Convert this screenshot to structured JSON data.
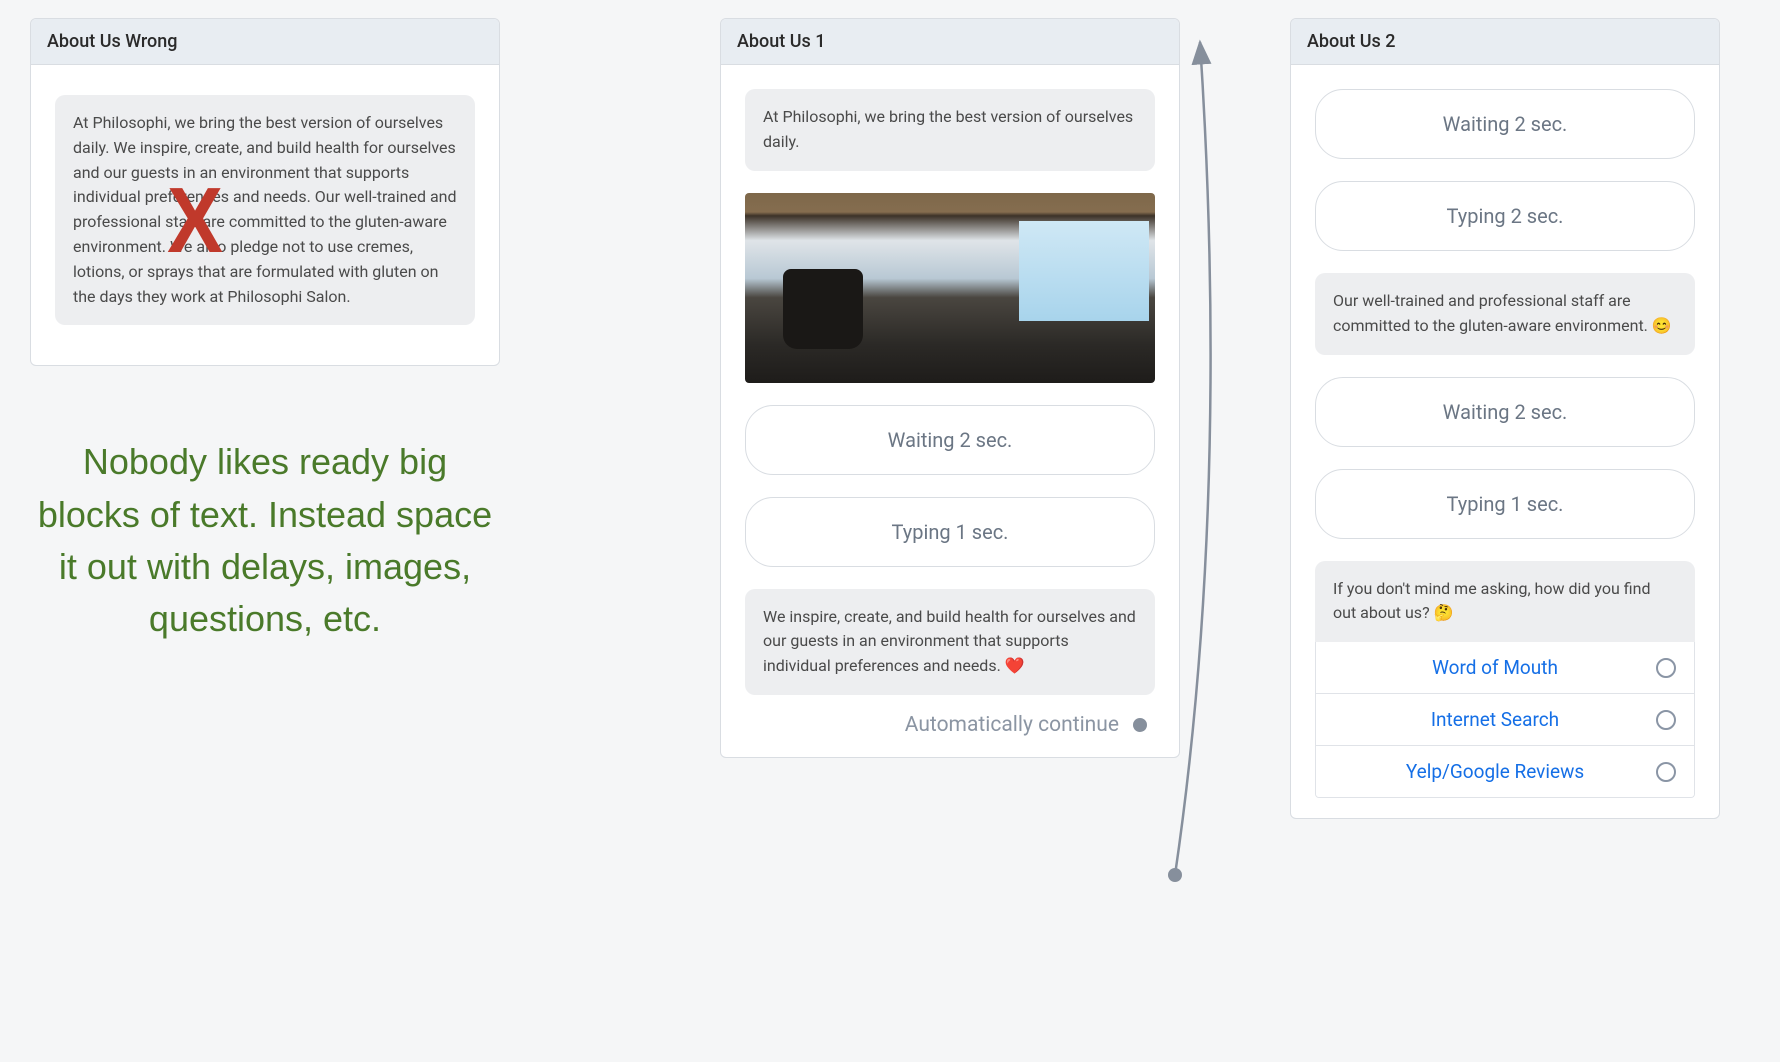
{
  "panels": {
    "wrong": {
      "title": "About Us Wrong",
      "message": "At Philosophi, we bring the best version of ourselves daily. We inspire, create, and build health for ourselves and our guests in an environment that supports individual preferences and needs. Our well-trained and professional staff are committed to the gluten-aware environment. We also pledge not to use cremes, lotions, or sprays that are formulated with gluten on the days they work at Philosophi Salon."
    },
    "one": {
      "title": "About Us 1",
      "intro": "At Philosophi, we bring the best version of ourselves daily.",
      "waiting": "Waiting 2 sec.",
      "typing": "Typing 1 sec.",
      "detail": "We inspire, create, and build health for ourselves and our guests in an environment that supports individual preferences and needs. ❤️",
      "continue": "Automatically continue"
    },
    "two": {
      "title": "About Us 2",
      "waiting1": "Waiting 2 sec.",
      "typing1": "Typing 2 sec.",
      "staff": "Our well-trained and professional staff are committed to the gluten-aware environment. 😊",
      "waiting2": "Waiting 2 sec.",
      "typing2": "Typing 1 sec.",
      "question": "If you don't mind me asking, how did you find out about us? 🤔",
      "options": [
        "Word of Mouth",
        "Internet Search",
        "Yelp/Google Reviews"
      ]
    }
  },
  "caption": "Nobody likes ready big blocks of text.  Instead space it out with delays, images, questions, etc."
}
